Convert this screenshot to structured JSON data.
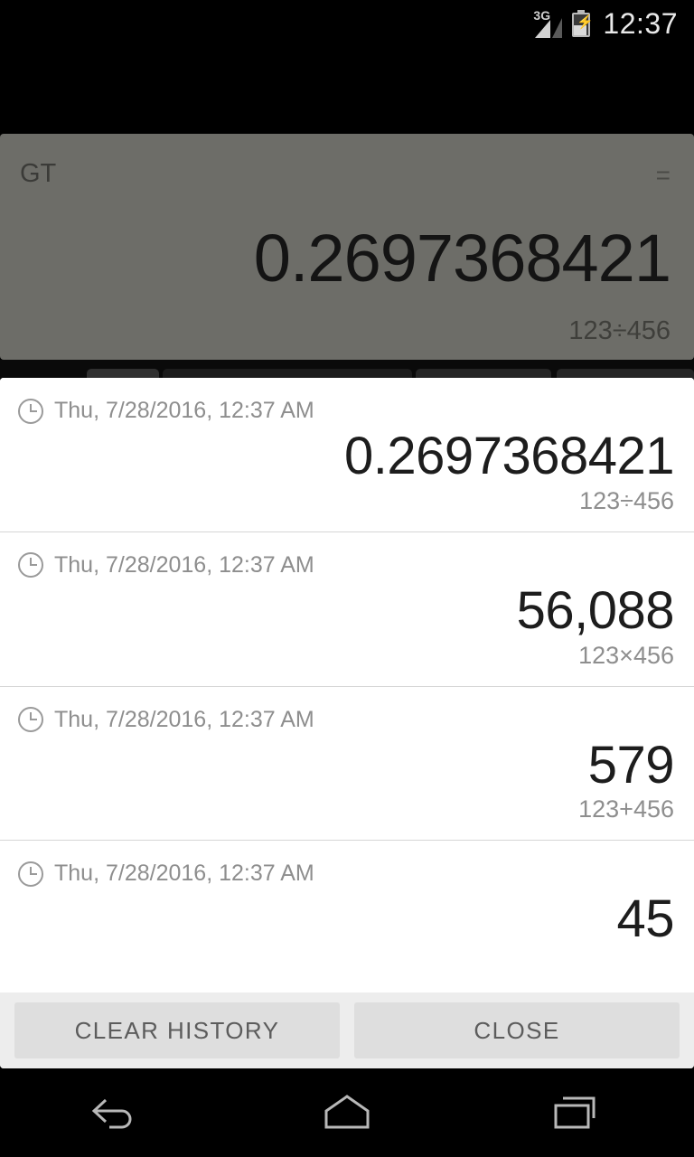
{
  "statusbar": {
    "network_label": "3G",
    "battery_icon": "battery-charging-icon",
    "signal_icon": "signal-3g-icon",
    "time": "12:37"
  },
  "calculator_display": {
    "memory_label": "GT",
    "equals_indicator": "=",
    "result": "0.2697368421",
    "expression": "123÷456"
  },
  "history_dialog": {
    "rows": [
      {
        "timestamp": "Thu, 7/28/2016, 12:37 AM",
        "result": "0.2697368421",
        "expression": "123÷456"
      },
      {
        "timestamp": "Thu, 7/28/2016, 12:37 AM",
        "result": "56,088",
        "expression": "123×456"
      },
      {
        "timestamp": "Thu, 7/28/2016, 12:37 AM",
        "result": "579",
        "expression": "123+456"
      },
      {
        "timestamp": "Thu, 7/28/2016, 12:37 AM",
        "result": "45",
        "expression": ""
      }
    ],
    "clear_button": "CLEAR HISTORY",
    "close_button": "CLOSE"
  },
  "navbar": {
    "back_icon": "back-arrow-icon",
    "home_icon": "home-icon",
    "recents_icon": "recent-apps-icon"
  },
  "colors": {
    "display_bg": "#6d6d68",
    "dialog_bg": "#ffffff",
    "action_bar_bg": "#ededed",
    "button_bg": "#dedede",
    "muted_text": "#8e8e8e",
    "primary_text": "#1d1d1d",
    "system_bg": "#000000"
  }
}
